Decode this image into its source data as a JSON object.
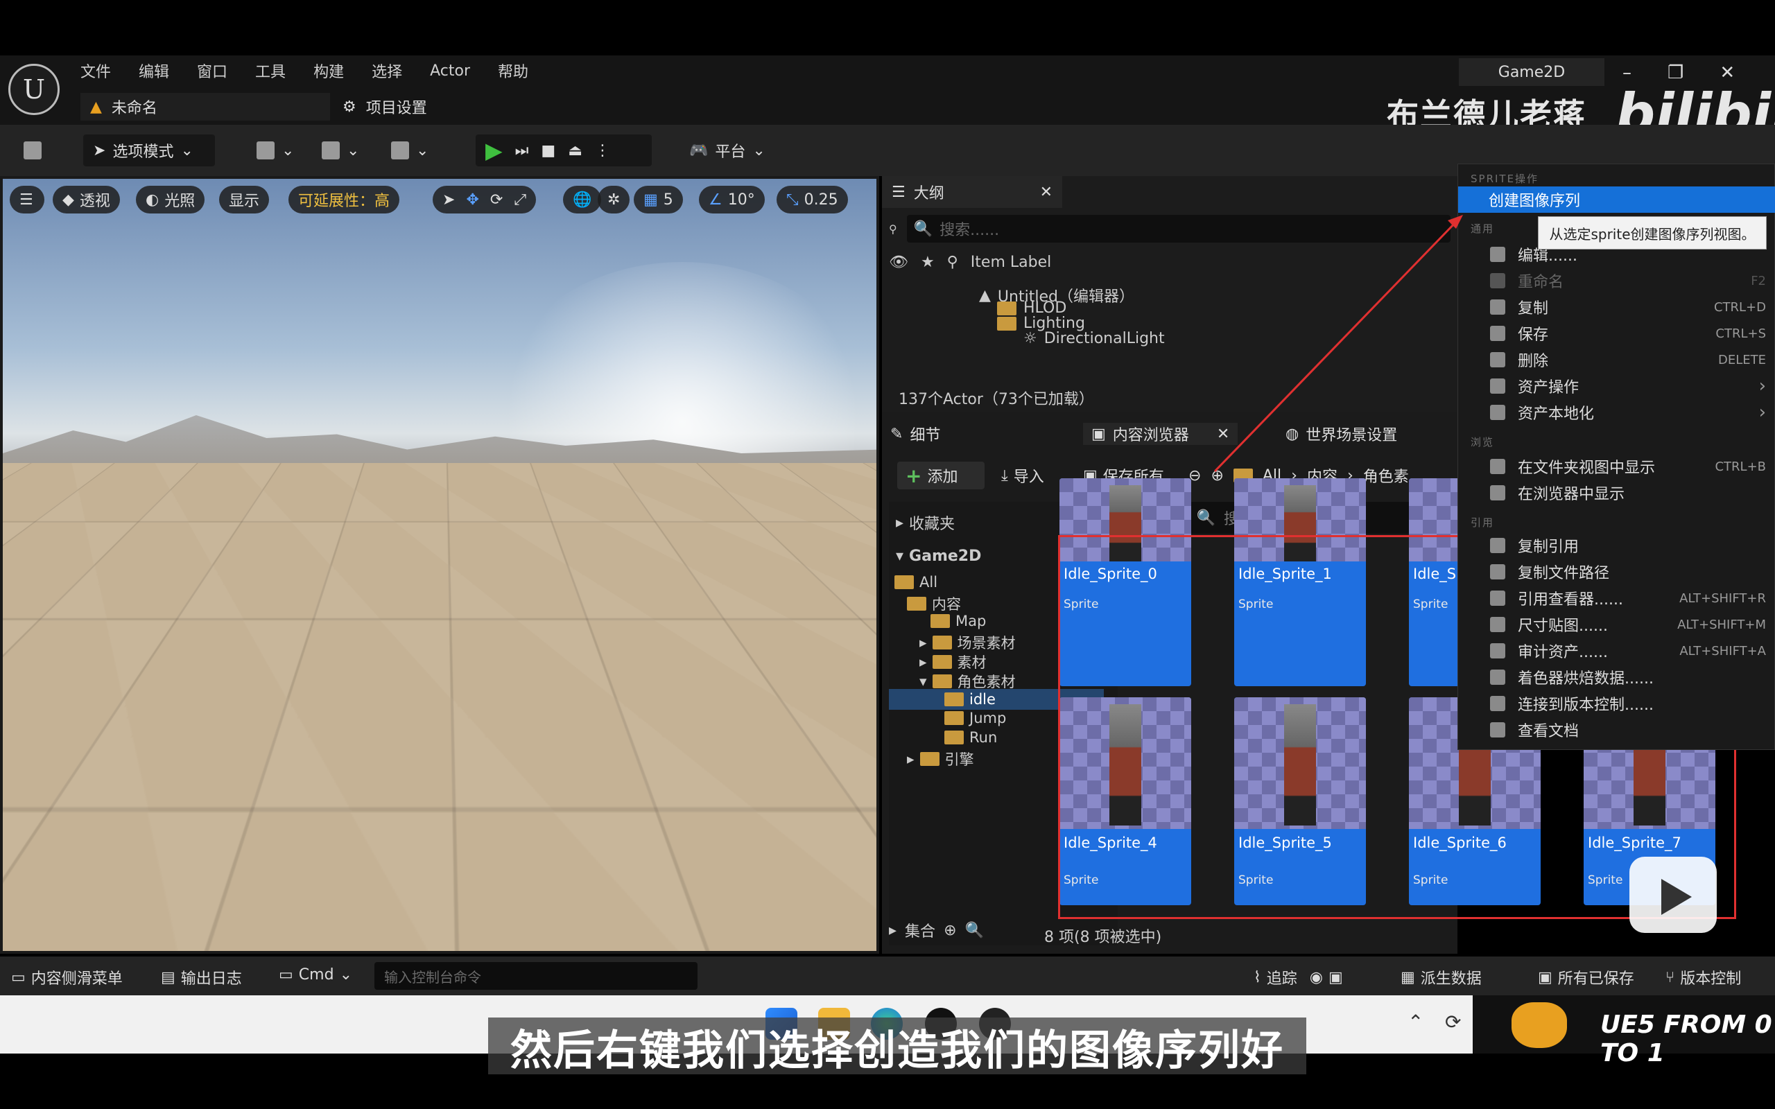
{
  "menu": [
    "文件",
    "编辑",
    "窗口",
    "工具",
    "构建",
    "选择",
    "Actor",
    "帮助"
  ],
  "tabs": {
    "level": "未命名",
    "project_settings": "项目设置"
  },
  "project_name": "Game2D",
  "watermark": {
    "author": "布兰德儿老蒋",
    "site": "bilibili"
  },
  "toolbar": {
    "mode": "选项模式",
    "platform": "平台",
    "settings": "设置"
  },
  "viewport": {
    "perspective": "透视",
    "lighting": "光照",
    "show": "显示",
    "scalability": "可延展性：高",
    "grid_value": "5",
    "angle_value": "10°",
    "scale_value": "0.25"
  },
  "outliner": {
    "title": "大纲",
    "search_placeholder": "搜索......",
    "column": "Item Label",
    "rows": [
      "Untitled（编辑器）",
      "HLOD",
      "Lighting",
      "DirectionalLight"
    ],
    "count": "137个Actor（73个已加载）"
  },
  "content_browser": {
    "tabs": {
      "details": "细节",
      "browser": "内容浏览器",
      "world": "世界场景设置"
    },
    "add": "添加",
    "import": "导入",
    "save_all": "保存所有",
    "breadcrumb": [
      "All",
      "内容",
      "角色素"
    ],
    "favorites": "收藏夹",
    "game": "Game2D",
    "tree": [
      "All",
      "内容",
      "Map",
      "场景素材",
      "素材",
      "角色素材",
      "idle",
      "Jump",
      "Run",
      "引擎"
    ],
    "collections": "集合",
    "search_value": "搜索 idle",
    "assets": [
      {
        "name": "Idle_Sprite_0",
        "type": "Sprite"
      },
      {
        "name": "Idle_Sprite_1",
        "type": "Sprite"
      },
      {
        "name": "Idle_Sp",
        "type": "Sprite"
      },
      {
        "name": "Idle_Sprite_4",
        "type": "Sprite"
      },
      {
        "name": "Idle_Sprite_5",
        "type": "Sprite"
      },
      {
        "name": "Idle_Sprite_6",
        "type": "Sprite"
      },
      {
        "name": "Idle_Sprite_7",
        "type": "Sprite"
      }
    ],
    "count": "8 项(8 项被选中)"
  },
  "context_menu": {
    "section_sprite": "SPRITE操作",
    "create_flipbook": "创建图像序列",
    "tooltip": "从选定sprite创建图像序列视图。",
    "section_common": "通用",
    "common": [
      {
        "label": "编辑......",
        "shortcut": ""
      },
      {
        "label": "重命名",
        "shortcut": "F2"
      },
      {
        "label": "复制",
        "shortcut": "CTRL+D"
      },
      {
        "label": "保存",
        "shortcut": "CTRL+S"
      },
      {
        "label": "删除",
        "shortcut": "DELETE"
      },
      {
        "label": "资产操作",
        "shortcut": "›"
      },
      {
        "label": "资产本地化",
        "shortcut": "›"
      }
    ],
    "section_explore": "浏览",
    "explore": [
      {
        "label": "在文件夹视图中显示",
        "shortcut": "CTRL+B"
      },
      {
        "label": "在浏览器中显示",
        "shortcut": ""
      }
    ],
    "section_refs": "引用",
    "refs": [
      {
        "label": "复制引用",
        "shortcut": ""
      },
      {
        "label": "复制文件路径",
        "shortcut": ""
      },
      {
        "label": "引用查看器......",
        "shortcut": "ALT+SHIFT+R"
      },
      {
        "label": "尺寸贴图......",
        "shortcut": "ALT+SHIFT+M"
      },
      {
        "label": "审计资产......",
        "shortcut": "ALT+SHIFT+A"
      },
      {
        "label": "着色器烘焙数据......",
        "shortcut": ""
      },
      {
        "label": "连接到版本控制......",
        "shortcut": ""
      },
      {
        "label": "查看文档",
        "shortcut": ""
      }
    ]
  },
  "statusbar": {
    "content_drawer": "内容侧滑菜单",
    "output_log": "输出日志",
    "cmd": "Cmd",
    "console_placeholder": "输入控制台命令",
    "trace": "追踪",
    "derived_data": "派生数据",
    "all_saved": "所有已保存",
    "source_control": "版本控制"
  },
  "subtitle": "然后右键我们选择创造我们的图像序列好",
  "brand": "UE5 FROM 0 TO 1",
  "colors": {
    "selection": "#1f6fe0",
    "highlight_red": "#e03030",
    "menu_blue": "#1570d8"
  }
}
